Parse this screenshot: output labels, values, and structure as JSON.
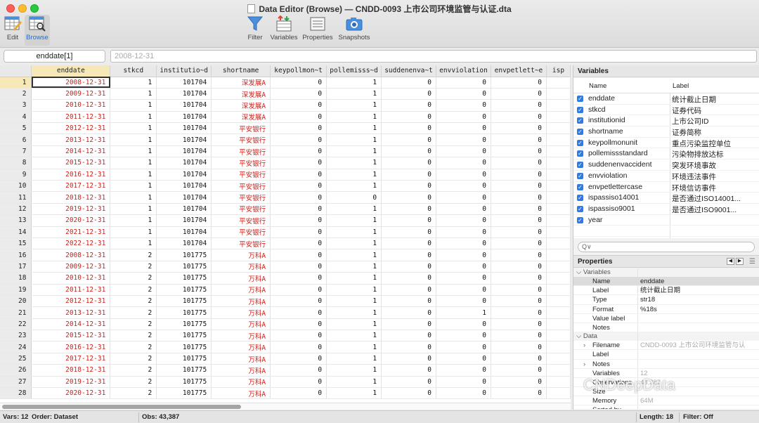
{
  "window": {
    "title": "Data Editor (Browse) — CNDD-0093 上市公司环境监管与认证.dta"
  },
  "toolbar": {
    "edit": "Edit",
    "browse": "Browse",
    "filter": "Filter",
    "variables": "Variables",
    "properties": "Properties",
    "snapshots": "Snapshots"
  },
  "editbar": {
    "cell_name": "enddate[1]",
    "cell_value": "2008-12-31"
  },
  "grid": {
    "columns": [
      "enddate",
      "stkcd",
      "institutio~d",
      "shortname",
      "keypollmon~t",
      "pollemisss~d",
      "suddenenva~t",
      "envviolation",
      "envpetlett~e",
      "isp"
    ],
    "rows": [
      [
        "1",
        "2008-12-31",
        "1",
        "101704",
        "深发展A",
        "0",
        "1",
        "0",
        "0",
        "0"
      ],
      [
        "2",
        "2009-12-31",
        "1",
        "101704",
        "深发展A",
        "0",
        "1",
        "0",
        "0",
        "0"
      ],
      [
        "3",
        "2010-12-31",
        "1",
        "101704",
        "深发展A",
        "0",
        "1",
        "0",
        "0",
        "0"
      ],
      [
        "4",
        "2011-12-31",
        "1",
        "101704",
        "深发展A",
        "0",
        "1",
        "0",
        "0",
        "0"
      ],
      [
        "5",
        "2012-12-31",
        "1",
        "101704",
        "平安银行",
        "0",
        "1",
        "0",
        "0",
        "0"
      ],
      [
        "6",
        "2013-12-31",
        "1",
        "101704",
        "平安银行",
        "0",
        "1",
        "0",
        "0",
        "0"
      ],
      [
        "7",
        "2014-12-31",
        "1",
        "101704",
        "平安银行",
        "0",
        "1",
        "0",
        "0",
        "0"
      ],
      [
        "8",
        "2015-12-31",
        "1",
        "101704",
        "平安银行",
        "0",
        "1",
        "0",
        "0",
        "0"
      ],
      [
        "9",
        "2016-12-31",
        "1",
        "101704",
        "平安银行",
        "0",
        "1",
        "0",
        "0",
        "0"
      ],
      [
        "10",
        "2017-12-31",
        "1",
        "101704",
        "平安银行",
        "0",
        "1",
        "0",
        "0",
        "0"
      ],
      [
        "11",
        "2018-12-31",
        "1",
        "101704",
        "平安银行",
        "0",
        "0",
        "0",
        "0",
        "0"
      ],
      [
        "12",
        "2019-12-31",
        "1",
        "101704",
        "平安银行",
        "0",
        "1",
        "0",
        "0",
        "0"
      ],
      [
        "13",
        "2020-12-31",
        "1",
        "101704",
        "平安银行",
        "0",
        "1",
        "0",
        "0",
        "0"
      ],
      [
        "14",
        "2021-12-31",
        "1",
        "101704",
        "平安银行",
        "0",
        "1",
        "0",
        "0",
        "0"
      ],
      [
        "15",
        "2022-12-31",
        "1",
        "101704",
        "平安银行",
        "0",
        "1",
        "0",
        "0",
        "0"
      ],
      [
        "16",
        "2008-12-31",
        "2",
        "101775",
        "万科A",
        "0",
        "1",
        "0",
        "0",
        "0"
      ],
      [
        "17",
        "2009-12-31",
        "2",
        "101775",
        "万科A",
        "0",
        "1",
        "0",
        "0",
        "0"
      ],
      [
        "18",
        "2010-12-31",
        "2",
        "101775",
        "万科A",
        "0",
        "1",
        "0",
        "0",
        "0"
      ],
      [
        "19",
        "2011-12-31",
        "2",
        "101775",
        "万科A",
        "0",
        "1",
        "0",
        "0",
        "0"
      ],
      [
        "20",
        "2012-12-31",
        "2",
        "101775",
        "万科A",
        "0",
        "1",
        "0",
        "0",
        "0"
      ],
      [
        "21",
        "2013-12-31",
        "2",
        "101775",
        "万科A",
        "0",
        "1",
        "0",
        "1",
        "0"
      ],
      [
        "22",
        "2014-12-31",
        "2",
        "101775",
        "万科A",
        "0",
        "1",
        "0",
        "0",
        "0"
      ],
      [
        "23",
        "2015-12-31",
        "2",
        "101775",
        "万科A",
        "0",
        "1",
        "0",
        "0",
        "0"
      ],
      [
        "24",
        "2016-12-31",
        "2",
        "101775",
        "万科A",
        "0",
        "1",
        "0",
        "0",
        "0"
      ],
      [
        "25",
        "2017-12-31",
        "2",
        "101775",
        "万科A",
        "0",
        "1",
        "0",
        "0",
        "0"
      ],
      [
        "26",
        "2018-12-31",
        "2",
        "101775",
        "万科A",
        "0",
        "1",
        "0",
        "0",
        "0"
      ],
      [
        "27",
        "2019-12-31",
        "2",
        "101775",
        "万科A",
        "0",
        "1",
        "0",
        "0",
        "0"
      ],
      [
        "28",
        "2020-12-31",
        "2",
        "101775",
        "万科A",
        "0",
        "1",
        "0",
        "0",
        "0"
      ]
    ]
  },
  "variables_panel": {
    "title": "Variables",
    "col_name": "Name",
    "col_label": "Label",
    "items": [
      {
        "name": "enddate",
        "label": "统计截止日期"
      },
      {
        "name": "stkcd",
        "label": "证券代码"
      },
      {
        "name": "institutionid",
        "label": "上市公司ID"
      },
      {
        "name": "shortname",
        "label": "证券简称"
      },
      {
        "name": "keypollmonunit",
        "label": "重点污染监控单位"
      },
      {
        "name": "pollemissstandard",
        "label": "污染物排放达标"
      },
      {
        "name": "suddenenvaccident",
        "label": "突发环境事故"
      },
      {
        "name": "envviolation",
        "label": "环境违法事件"
      },
      {
        "name": "envpetlettercase",
        "label": "环境信访事件"
      },
      {
        "name": "ispassiso14001",
        "label": "是否通过ISO14001..."
      },
      {
        "name": "ispassiso9001",
        "label": "是否通过ISO9001..."
      },
      {
        "name": "year",
        "label": ""
      }
    ],
    "search_placeholder": "Q∨"
  },
  "properties_panel": {
    "title": "Properties",
    "variables_section": "Variables",
    "variables": [
      {
        "key": "Name",
        "value": "enddate"
      },
      {
        "key": "Label",
        "value": "统计截止日期"
      },
      {
        "key": "Type",
        "value": "str18"
      },
      {
        "key": "Format",
        "value": "%18s"
      },
      {
        "key": "Value label",
        "value": ""
      },
      {
        "key": "Notes",
        "value": ""
      }
    ],
    "data_section": "Data",
    "data": [
      {
        "key": "Filename",
        "value": "CNDD-0093 上市公司环境监管与认",
        "expand": true
      },
      {
        "key": "Label",
        "value": "",
        "expand": false
      },
      {
        "key": "Notes",
        "value": "",
        "expand": true
      },
      {
        "key": "Variables",
        "value": "12",
        "expand": false
      },
      {
        "key": "Observations",
        "value": "43,387",
        "expand": false
      },
      {
        "key": "Size",
        "value": "",
        "expand": false
      },
      {
        "key": "Memory",
        "value": "64M",
        "expand": false
      },
      {
        "key": "Sorted by",
        "value": "",
        "expand": false
      }
    ]
  },
  "status": {
    "vars": "Vars: 12",
    "order": "Order: Dataset",
    "obs": "Obs: 43,387",
    "length": "Length: 18",
    "filter": "Filter: Off"
  },
  "watermark": "CNDeepData"
}
